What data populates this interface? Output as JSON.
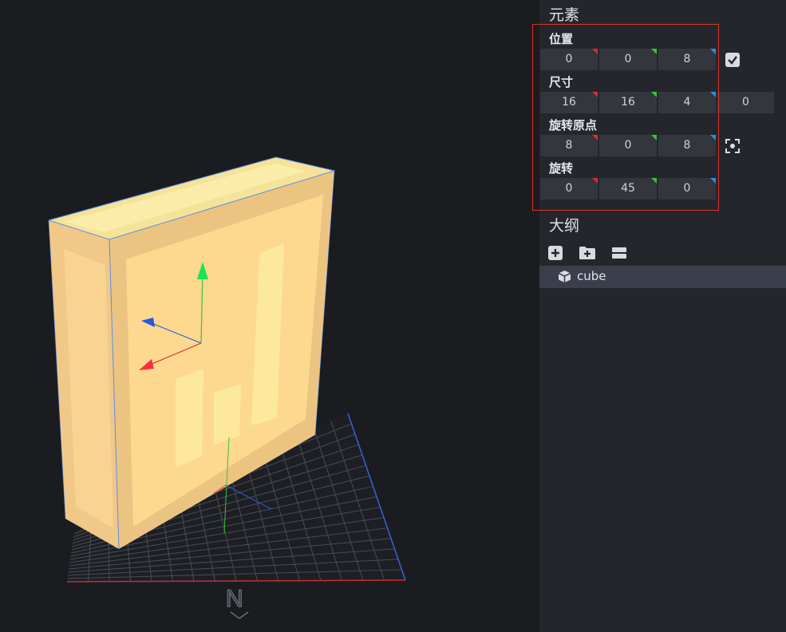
{
  "panel": {
    "element_title": "元素",
    "position": {
      "label": "位置",
      "values": [
        "0",
        "0",
        "8"
      ]
    },
    "size": {
      "label": "尺寸",
      "values": [
        "16",
        "16",
        "4",
        "0"
      ]
    },
    "pivot": {
      "label": "旋转原点",
      "values": [
        "8",
        "0",
        "8"
      ]
    },
    "rotation": {
      "label": "旋转",
      "values": [
        "0",
        "45",
        "0"
      ]
    },
    "outline_title": "大纲",
    "outline_items": [
      {
        "label": "cube",
        "icon": "cube-icon"
      }
    ]
  },
  "viewport": {
    "compass_label": "N"
  },
  "colors": {
    "axis_x": "#e02a33",
    "axis_y": "#3cc23a",
    "axis_z": "#2f8fe0",
    "highlight": "#d9342b"
  }
}
